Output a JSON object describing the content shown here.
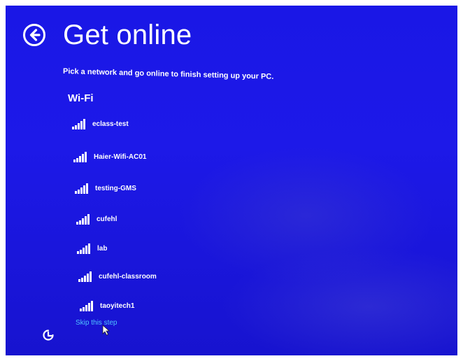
{
  "header": {
    "back_icon": "back-arrow-circle-icon",
    "title": "Get online"
  },
  "instructions": "Pick a network and go online to finish setting up your PC.",
  "wifi": {
    "label": "Wi-Fi",
    "networks": [
      {
        "name": "eclass-test",
        "icon": "wifi-signal-icon"
      },
      {
        "name": "Haier-Wifi-AC01",
        "icon": "wifi-signal-icon"
      },
      {
        "name": "testing-GMS",
        "icon": "wifi-signal-icon"
      },
      {
        "name": "cufehl",
        "icon": "wifi-signal-icon"
      },
      {
        "name": "lab",
        "icon": "wifi-signal-icon"
      },
      {
        "name": "cufehl-classroom",
        "icon": "wifi-signal-icon"
      },
      {
        "name": "taoyitech1",
        "icon": "wifi-signal-icon"
      }
    ]
  },
  "skip_label": "Skip this step",
  "ease_of_access_icon": "ease-of-access-icon",
  "colors": {
    "background": "#1d19e8",
    "text": "#ffffff",
    "link": "#4fc3ff"
  }
}
